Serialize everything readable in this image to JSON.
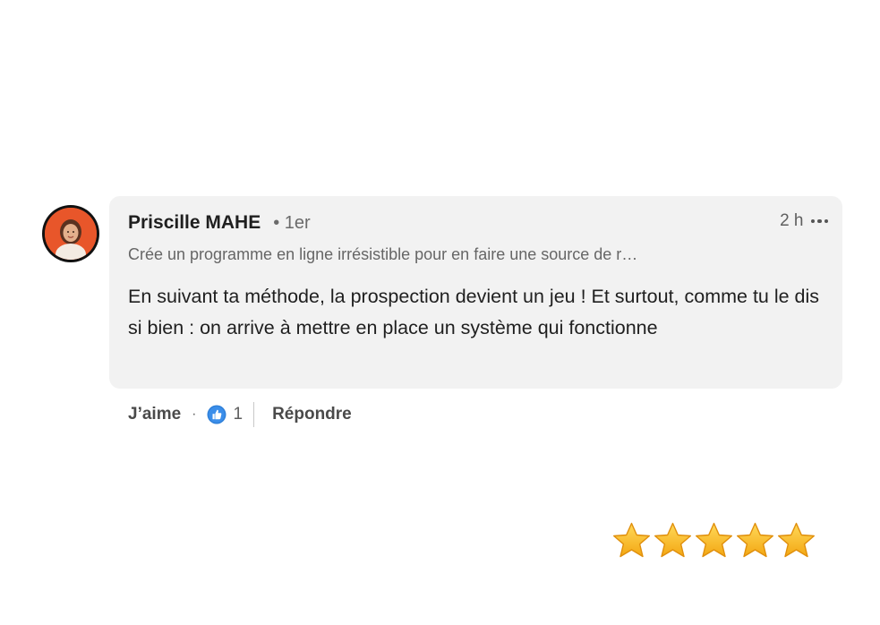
{
  "comment": {
    "author": {
      "name": "Priscille MAHE",
      "connection": "• 1er",
      "headline": "Crée un programme en ligne irrésistible pour en faire une source de r…"
    },
    "timestamp": "2 h",
    "text": "En suivant ta méthode, la prospection devient un jeu ! Et surtout, comme tu le dis si bien : on arrive à mettre en place un système qui fonctionne",
    "actions": {
      "like_label": "J’aime",
      "separator": "·",
      "reaction_count": "1",
      "reply_label": "Répondre"
    },
    "icons": {
      "avatar": "avatar",
      "more": "more-options-icon",
      "reaction": "like-reaction-icon"
    }
  },
  "rating": {
    "stars": 5,
    "max": 5,
    "icon": "star-icon",
    "color": "#f5b51c"
  },
  "colors": {
    "bubble": "#f2f2f2",
    "avatar_bg": "#e8562a",
    "like_blue": "#2f80d9"
  }
}
